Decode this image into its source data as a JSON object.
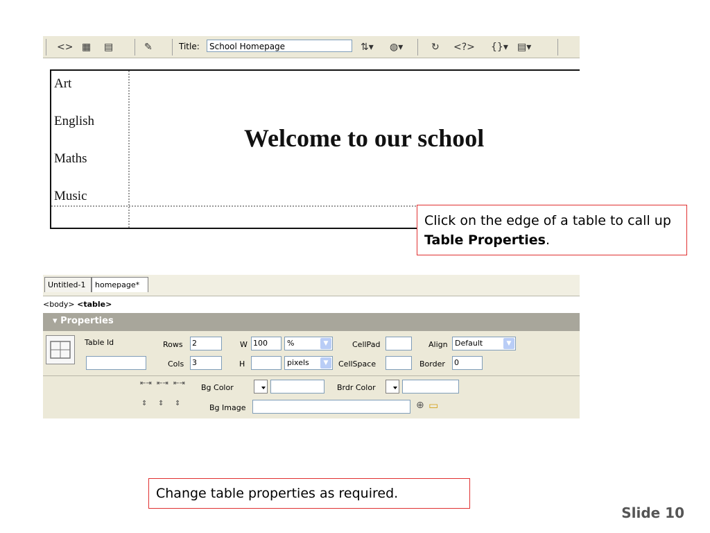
{
  "toolbar": {
    "title_label": "Title:",
    "title_value": "School Homepage",
    "icons": [
      "code-view-icon",
      "split-view-icon",
      "design-view-icon",
      "live-data-icon",
      "file-management-icon",
      "preview-browser-icon",
      "refresh-icon",
      "view-options-icon",
      "visual-aids-icon"
    ]
  },
  "canvas": {
    "nav_items": [
      "Art",
      "English",
      "Maths",
      "Music"
    ],
    "heading": "Welcome to our school"
  },
  "callout_top": {
    "text_part1": "Click on the edge of a table to call up ",
    "text_bold": "Table Properties",
    "text_part2": "."
  },
  "document_tabs": [
    "Untitled-1",
    "homepage*"
  ],
  "tag_selector": {
    "body": "<body>",
    "table": "<table>"
  },
  "properties": {
    "title": "Properties",
    "table_id_label": "Table Id",
    "table_id_value": "",
    "rows_label": "Rows",
    "rows_value": "2",
    "cols_label": "Cols",
    "cols_value": "3",
    "w_label": "W",
    "w_value": "100",
    "w_unit": "%",
    "h_label": "H",
    "h_value": "",
    "h_unit": "pixels",
    "cellpad_label": "CellPad",
    "cellpad_value": "",
    "cellspace_label": "CellSpace",
    "cellspace_value": "",
    "align_label": "Align",
    "align_value": "Default",
    "border_label": "Border",
    "border_value": "0",
    "bgcolor_label": "Bg Color",
    "bgcolor_value": "",
    "brdrcolor_label": "Brdr Color",
    "brdrcolor_value": "",
    "bgimage_label": "Bg Image",
    "bgimage_value": ""
  },
  "callout_bottom": {
    "text": "Change table properties as required."
  },
  "slide": {
    "label": "Slide 10"
  },
  "colors": {
    "panel_bg": "#ece9d8",
    "callout_border": "#e03030",
    "header_bar": "#a8a69b"
  }
}
